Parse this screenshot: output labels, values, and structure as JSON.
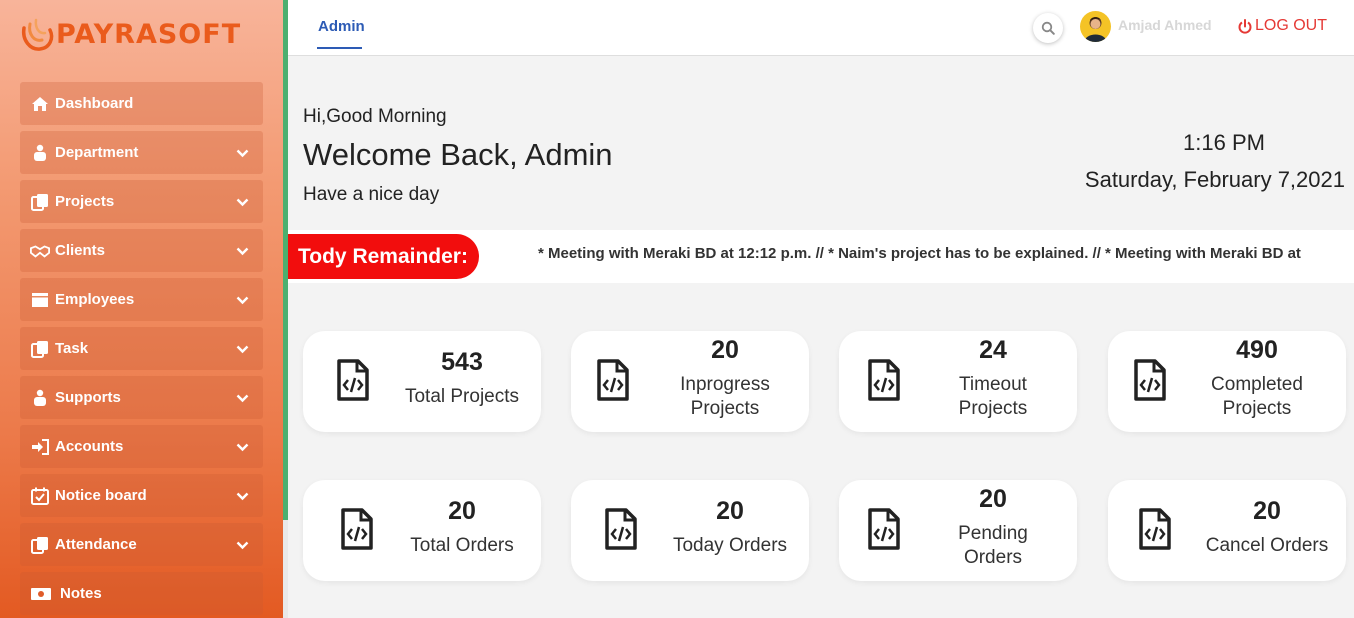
{
  "brand": {
    "name": "PAYRASOFT"
  },
  "sidebar": {
    "items": [
      {
        "label": "Dashboard",
        "icon": "home-icon",
        "has_chevron": false
      },
      {
        "label": "Department",
        "icon": "users-icon",
        "has_chevron": true
      },
      {
        "label": "Projects",
        "icon": "copy-icon",
        "has_chevron": true
      },
      {
        "label": "Clients",
        "icon": "handshake-icon",
        "has_chevron": true
      },
      {
        "label": "Employees",
        "icon": "archive-icon",
        "has_chevron": true
      },
      {
        "label": "Task",
        "icon": "copy-icon",
        "has_chevron": true
      },
      {
        "label": "Supports",
        "icon": "users-icon",
        "has_chevron": true
      },
      {
        "label": "Accounts",
        "icon": "sign-in-icon",
        "has_chevron": true
      },
      {
        "label": "Notice board",
        "icon": "calendar-check-icon",
        "has_chevron": true
      },
      {
        "label": "Attendance",
        "icon": "copy-icon",
        "has_chevron": true
      },
      {
        "label": "Notes",
        "icon": "money-icon",
        "has_chevron": false
      }
    ]
  },
  "header": {
    "active_tab": "Admin",
    "user_name": "Amjad Ahmed",
    "logout_label": "LOG OUT"
  },
  "greeting": {
    "salutation": "Hi,Good Morning",
    "welcome": "Welcome Back, Admin",
    "subtitle": "Have a nice day"
  },
  "clock": {
    "time": "1:16 PM",
    "date": "Saturday, February 7,2021"
  },
  "reminder": {
    "label": "Tody Remainder:",
    "text": "* Meeting with Meraki BD at 12:12 p.m. // * Naim's project has to be explained. // * Meeting with Meraki BD at"
  },
  "stats": {
    "projects": [
      {
        "value": "543",
        "label": "Total Projects"
      },
      {
        "value": "20",
        "label": "Inprogress Projects"
      },
      {
        "value": "24",
        "label": "Timeout Projects"
      },
      {
        "value": "490",
        "label": "Completed Projects"
      }
    ],
    "orders": [
      {
        "value": "20",
        "label": "Total Orders"
      },
      {
        "value": "20",
        "label": "Today Orders"
      },
      {
        "value": "20",
        "label": "Pending Orders"
      },
      {
        "value": "20",
        "label": "Cancel Orders"
      }
    ]
  },
  "colors": {
    "accent_blue": "#2d5bb5",
    "logout_red": "#e53935",
    "reminder_red": "#f20d0d",
    "brand_orange": "#ea5b1c"
  }
}
